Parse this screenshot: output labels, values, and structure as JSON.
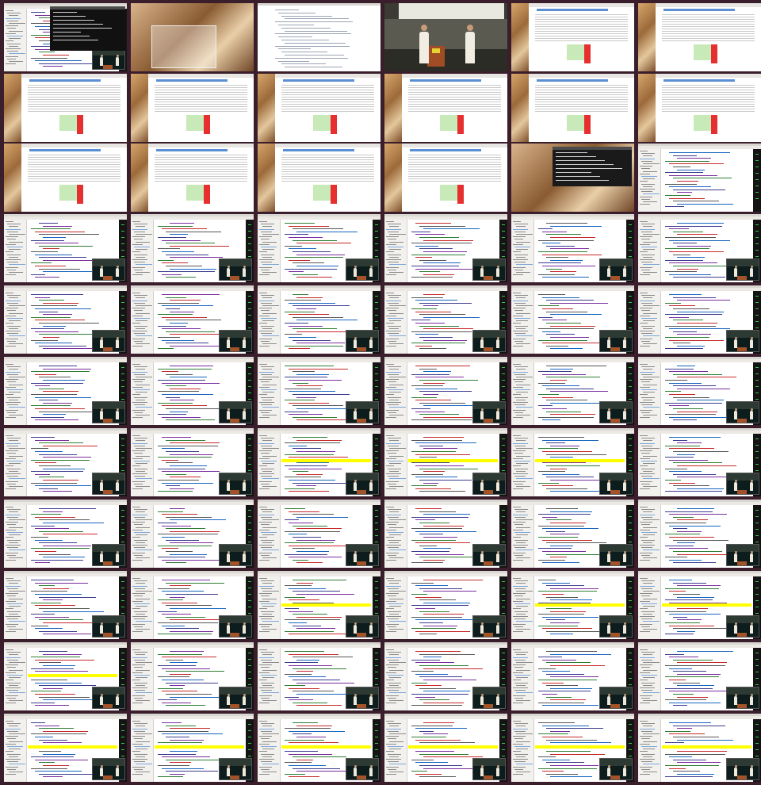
{
  "sheet": {
    "title": "",
    "columns": 6,
    "rows": 11
  },
  "colors": {
    "background": "#3a1e2c",
    "highlight": "#ffff00",
    "terminal_text": "#39c24a",
    "table_header": "#5b8fd3",
    "status_red": "#e63030",
    "status_green": "#c8e9b8",
    "podium": "#a04c25"
  },
  "icons": {
    "terminal": "terminal-icon",
    "camera_inset": "camera-inset-icon"
  },
  "tiles": [
    {
      "kind": "terminal-editor"
    },
    {
      "kind": "desktop-window"
    },
    {
      "kind": "document"
    },
    {
      "kind": "stage"
    },
    {
      "kind": "web"
    },
    {
      "kind": "web"
    },
    {
      "kind": "web"
    },
    {
      "kind": "web"
    },
    {
      "kind": "web"
    },
    {
      "kind": "web"
    },
    {
      "kind": "web"
    },
    {
      "kind": "web"
    },
    {
      "kind": "web"
    },
    {
      "kind": "web"
    },
    {
      "kind": "web"
    },
    {
      "kind": "web"
    },
    {
      "kind": "desktop-terminal"
    },
    {
      "kind": "editor"
    },
    {
      "kind": "editor-cam"
    },
    {
      "kind": "editor-cam"
    },
    {
      "kind": "editor-cam"
    },
    {
      "kind": "editor-cam"
    },
    {
      "kind": "editor-cam"
    },
    {
      "kind": "editor-cam"
    },
    {
      "kind": "editor-cam"
    },
    {
      "kind": "editor-cam"
    },
    {
      "kind": "editor-cam"
    },
    {
      "kind": "editor-cam"
    },
    {
      "kind": "editor-cam"
    },
    {
      "kind": "editor-cam"
    },
    {
      "kind": "editor-cam"
    },
    {
      "kind": "editor-cam"
    },
    {
      "kind": "editor-cam"
    },
    {
      "kind": "editor-cam"
    },
    {
      "kind": "editor-cam"
    },
    {
      "kind": "editor-cam"
    },
    {
      "kind": "editor-cam"
    },
    {
      "kind": "editor-cam"
    },
    {
      "kind": "editor-cam",
      "highlight_row": 0.45
    },
    {
      "kind": "editor-cam",
      "highlight_row": 0.45
    },
    {
      "kind": "editor-cam",
      "highlight_row": 0.45
    },
    {
      "kind": "editor-cam"
    },
    {
      "kind": "editor-cam"
    },
    {
      "kind": "editor-cam"
    },
    {
      "kind": "editor-cam"
    },
    {
      "kind": "editor-cam"
    },
    {
      "kind": "editor-cam"
    },
    {
      "kind": "editor-cam"
    },
    {
      "kind": "editor-cam"
    },
    {
      "kind": "editor-cam"
    },
    {
      "kind": "editor-cam",
      "highlight_row": 0.48
    },
    {
      "kind": "editor-cam"
    },
    {
      "kind": "editor-cam",
      "highlight_row": 0.48
    },
    {
      "kind": "editor-cam",
      "highlight_row": 0.48
    },
    {
      "kind": "editor-cam",
      "highlight_row": 0.47
    },
    {
      "kind": "editor-cam"
    },
    {
      "kind": "editor-cam"
    },
    {
      "kind": "editor-cam"
    },
    {
      "kind": "editor-cam"
    },
    {
      "kind": "editor-cam"
    },
    {
      "kind": "editor-cam",
      "highlight_row": 0.47
    },
    {
      "kind": "editor-cam",
      "highlight_row": 0.47
    },
    {
      "kind": "editor-cam",
      "highlight_row": 0.47
    },
    {
      "kind": "editor-cam",
      "highlight_row": 0.47
    },
    {
      "kind": "editor-cam",
      "highlight_row": 0.47
    },
    {
      "kind": "editor-cam",
      "highlight_row": 0.47
    }
  ]
}
